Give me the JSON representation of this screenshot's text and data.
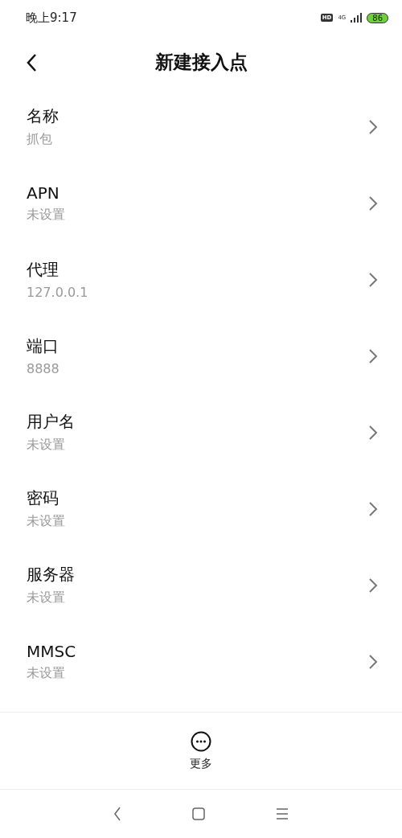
{
  "status_bar": {
    "time": "晚上9:17",
    "hd": "HD",
    "network": "4G",
    "battery": "86"
  },
  "header": {
    "title": "新建接入点"
  },
  "fields": [
    {
      "label": "名称",
      "value": "抓包"
    },
    {
      "label": "APN",
      "value": "未设置"
    },
    {
      "label": "代理",
      "value": "127.0.0.1"
    },
    {
      "label": "端口",
      "value": "8888"
    },
    {
      "label": "用户名",
      "value": "未设置"
    },
    {
      "label": "密码",
      "value": "未设置"
    },
    {
      "label": "服务器",
      "value": "未设置"
    },
    {
      "label": "MMSC",
      "value": "未设置"
    }
  ],
  "bottom_action": {
    "label": "更多"
  }
}
